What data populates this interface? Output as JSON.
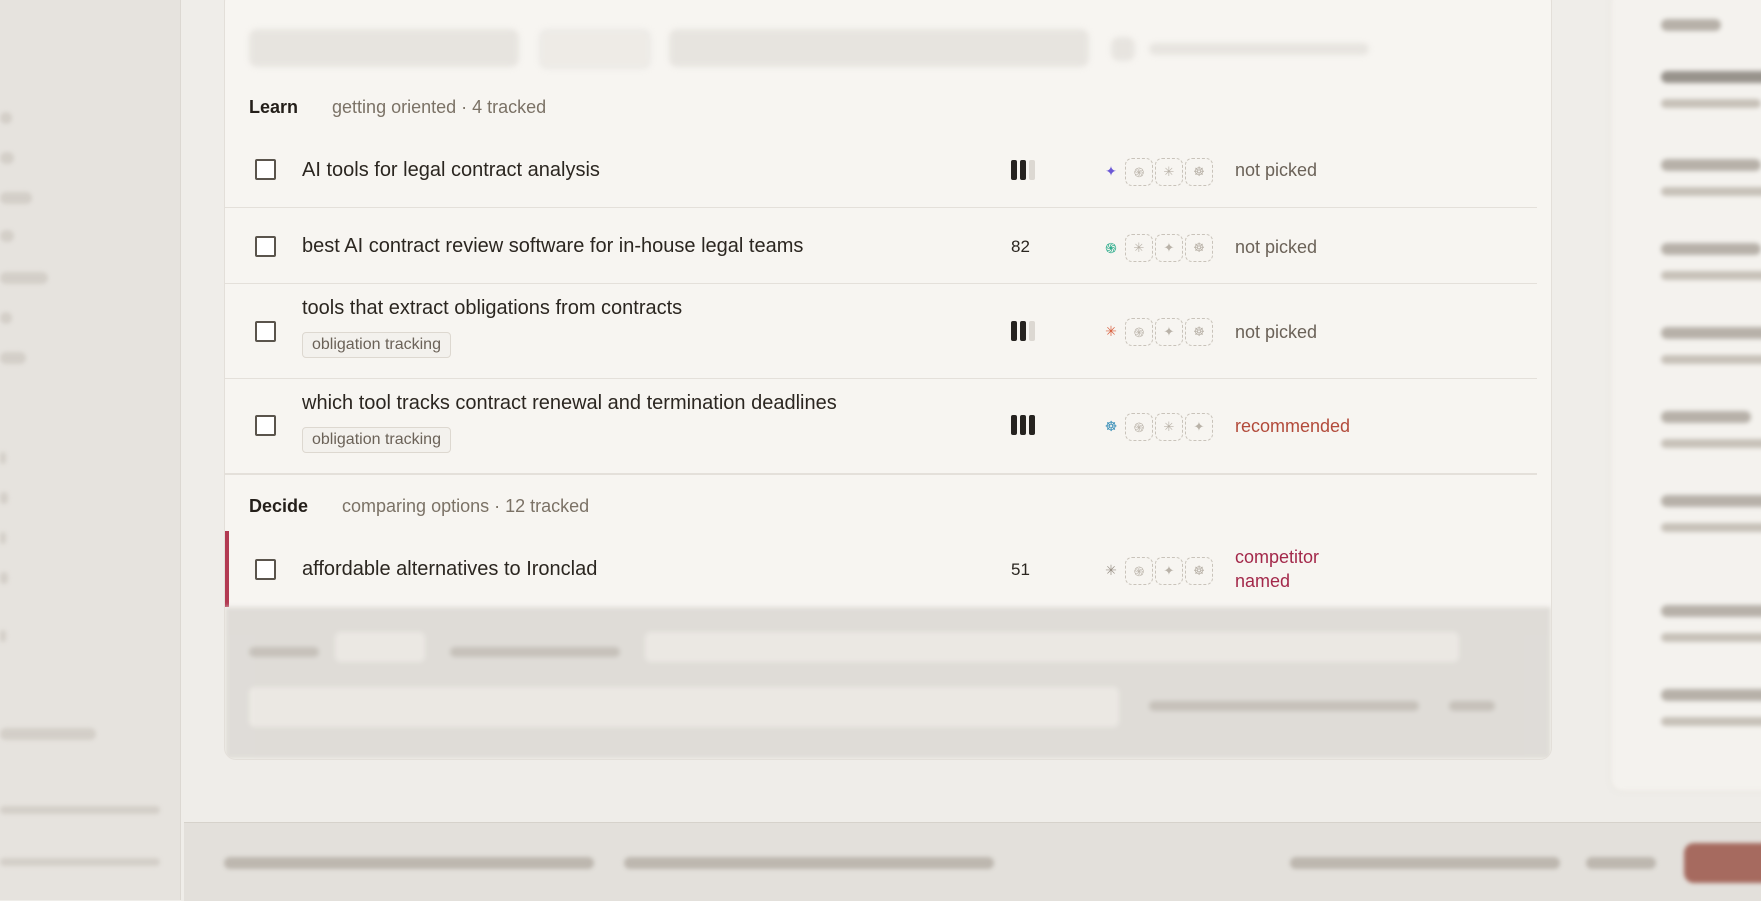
{
  "sections": [
    {
      "title": "Learn",
      "subtitle": "getting oriented · 4 tracked",
      "rows": [
        {
          "prompt": "AI tools for legal contract analysis",
          "bars": 2,
          "score": null,
          "lead_engine": "gemini",
          "status": "not picked"
        },
        {
          "prompt": "best AI contract review software for in-house legal teams",
          "bars": null,
          "score": "82",
          "lead_engine": "chatgpt",
          "status": "not picked"
        },
        {
          "prompt": "tools that extract obligations from contracts",
          "tag": "obligation tracking",
          "bars": 2,
          "score": null,
          "lead_engine": "claude",
          "status": "not picked"
        },
        {
          "prompt": "which tool tracks contract renewal and termination deadlines",
          "tag": "obligation tracking",
          "bars": 3,
          "score": null,
          "lead_engine": "copilot",
          "status": "recommended"
        }
      ]
    },
    {
      "title": "Decide",
      "subtitle": "comparing options · 12 tracked",
      "rows": [
        {
          "prompt": "affordable alternatives to Ironclad",
          "bars": null,
          "score": "51",
          "lead_engine": "perplexity",
          "status_line1": "competitor",
          "status_line2": "named"
        }
      ]
    }
  ],
  "colors": {
    "accent": "#b23a52",
    "recommended": "#b24a3a",
    "competitor": "#a3284a",
    "muted": "#6b6258"
  },
  "icons": {
    "gemini": "✦",
    "chatgpt": "֍",
    "claude": "✳",
    "copilot": "☸",
    "perplexity": "✳"
  }
}
